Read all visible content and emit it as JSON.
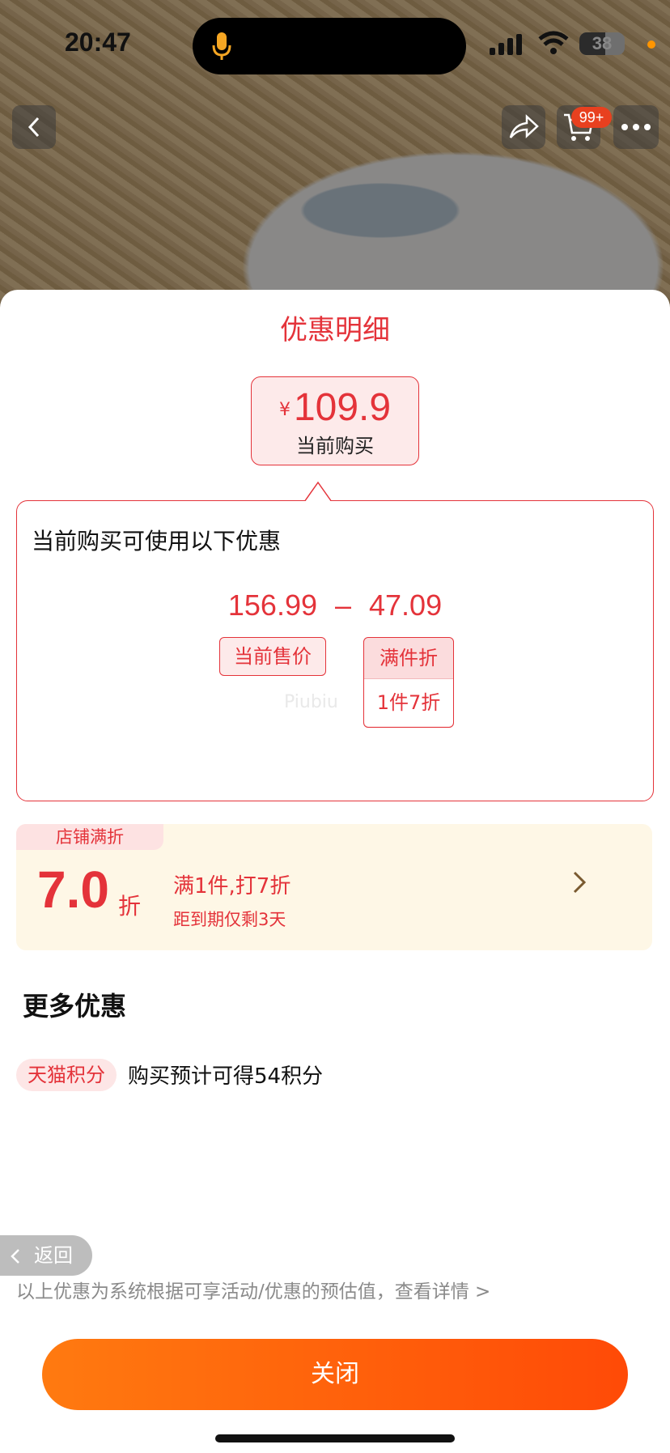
{
  "status_bar": {
    "time": "20:47",
    "battery": "38"
  },
  "nav": {
    "cart_badge": "99+"
  },
  "sheet": {
    "title": "优惠明细",
    "price": {
      "currency": "¥",
      "value": "109.9",
      "label": "当前购买"
    },
    "detail": {
      "heading": "当前购买可使用以下优惠",
      "original_price": "156.99",
      "minus": "–",
      "discount_amount": "47.09",
      "tag_price": "当前售价",
      "tag_discount_top": "满件折",
      "tag_discount_bottom": "1件7折",
      "watermark": "Piubiu"
    },
    "shop_card": {
      "tag": "店铺满折",
      "discount": "7.0",
      "unit": "折",
      "rule": "满1件,打7折",
      "expire": "距到期仅剩3天"
    },
    "more": {
      "title": "更多优惠",
      "points_tag": "天猫积分",
      "points_text": "购买预计可得54积分"
    },
    "back_label": "返回",
    "disclaimer": "以上优惠为系统根据可享活动/优惠的预估值，查看详情 >",
    "close_label": "关闭"
  },
  "colors": {
    "accent_red": "#e4333a",
    "button_orange_start": "#ff7a10",
    "button_orange_end": "#ff4a07",
    "shop_card_bg": "#fef7e6"
  }
}
